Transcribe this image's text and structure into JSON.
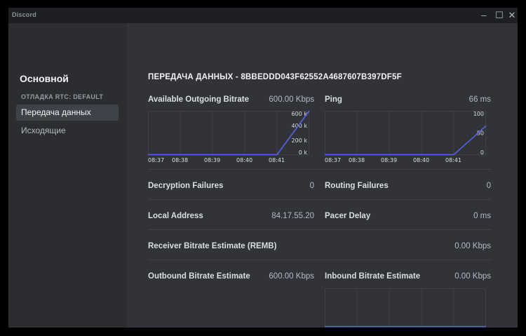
{
  "window": {
    "app_title": "Discord",
    "minimize_glyph": "–",
    "maximize_glyph": "☐",
    "close_glyph": "✕"
  },
  "sidebar": {
    "title": "Основной",
    "section_header": "ОТЛАДКА RTC: DEFAULT",
    "items": [
      {
        "label": "Передача данных",
        "active": true
      },
      {
        "label": "Исходящие",
        "active": false
      }
    ]
  },
  "main": {
    "title": "ПЕРЕДАЧА ДАННЫХ - 8BBEDDD043F62552A4687607B397DF5F",
    "stats": {
      "outgoing_bitrate": {
        "label": "Available Outgoing Bitrate",
        "value": "600.00 Kbps"
      },
      "ping": {
        "label": "Ping",
        "value": "66 ms"
      },
      "decryption_failures": {
        "label": "Decryption Failures",
        "value": "0"
      },
      "routing_failures": {
        "label": "Routing Failures",
        "value": "0"
      },
      "local_address": {
        "label": "Local Address",
        "value": "84.17.55.20"
      },
      "pacer_delay": {
        "label": "Pacer Delay",
        "value": "0 ms"
      },
      "remb": {
        "label": "Receiver Bitrate Estimate (REMB)",
        "value": "0.00 Kbps"
      },
      "outbound_estimate": {
        "label": "Outbound Bitrate Estimate",
        "value": "600.00 Kbps"
      },
      "inbound_estimate": {
        "label": "Inbound Bitrate Estimate",
        "value": "0.00 Kbps"
      }
    }
  },
  "chart_data": [
    {
      "type": "line",
      "x": [
        "08:37",
        "08:38",
        "08:39",
        "08:40",
        "08:41"
      ],
      "y_ticks": [
        "600 k",
        "400 k",
        "200 k",
        "0 k"
      ],
      "y_tick_values": [
        600,
        400,
        200,
        0
      ],
      "ylim": [
        0,
        600
      ],
      "series": [
        {
          "values": [
            0,
            0,
            0,
            0,
            0,
            600
          ]
        }
      ],
      "line_color": "#5865f2",
      "grid": true
    },
    {
      "type": "line",
      "x": [
        "08:37",
        "08:38",
        "08:39",
        "08:40",
        "08:41"
      ],
      "y_ticks": [
        "100",
        "50",
        "0"
      ],
      "y_tick_values": [
        100,
        50,
        0
      ],
      "ylim": [
        0,
        100
      ],
      "series": [
        {
          "values": [
            0,
            0,
            0,
            0,
            0,
            66
          ]
        }
      ],
      "line_color": "#5865f2",
      "grid": true
    },
    {
      "type": "line",
      "x": [],
      "y_ticks": [],
      "y_tick_values": [],
      "ylim": [
        0,
        1
      ],
      "series": [
        {
          "values": [
            0,
            0,
            0,
            0,
            0,
            0
          ]
        }
      ],
      "line_color": "#5865f2",
      "grid": true
    }
  ]
}
